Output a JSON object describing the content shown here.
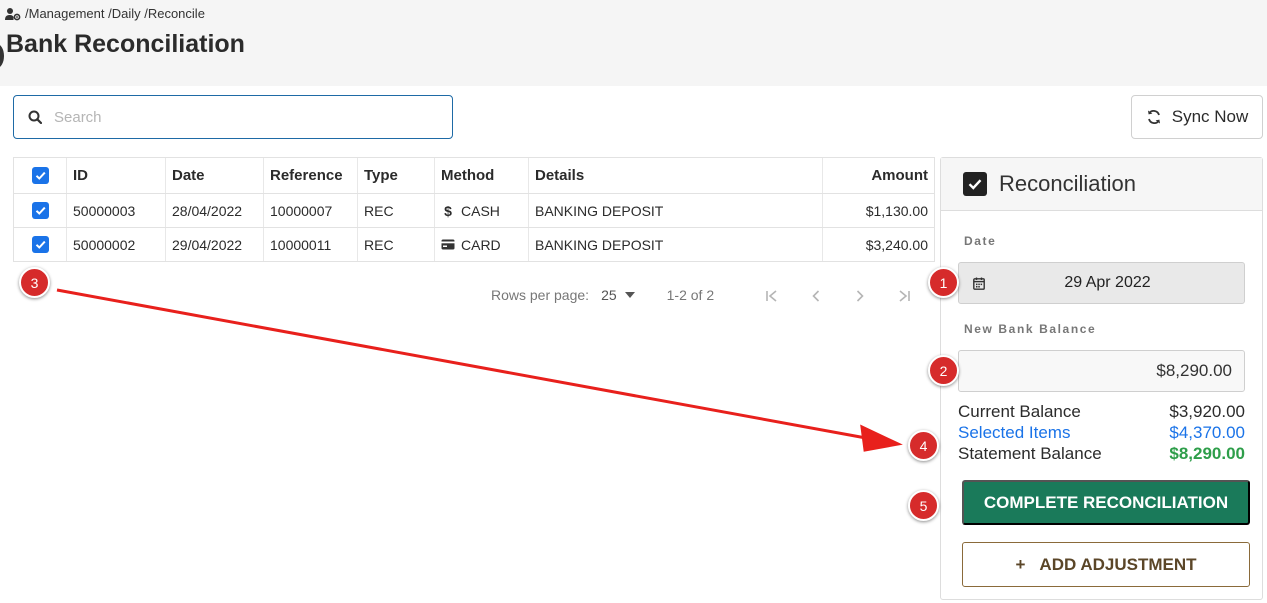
{
  "breadcrumb": "/Management /Daily /Reconcile",
  "page_title": "Bank Reconciliation",
  "search": {
    "placeholder": "Search"
  },
  "sync_button": "Sync Now",
  "table": {
    "headers": {
      "id": "ID",
      "date": "Date",
      "reference": "Reference",
      "type": "Type",
      "method": "Method",
      "details": "Details",
      "amount": "Amount"
    },
    "rows": [
      {
        "id": "50000003",
        "date": "28/04/2022",
        "reference": "10000007",
        "type": "REC",
        "method": "CASH",
        "method_icon": "dollar-icon",
        "details": "BANKING DEPOSIT",
        "amount": "$1,130.00",
        "checked": true
      },
      {
        "id": "50000002",
        "date": "29/04/2022",
        "reference": "10000011",
        "type": "REC",
        "method": "CARD",
        "method_icon": "credit-card-icon",
        "details": "BANKING DEPOSIT",
        "amount": "$3,240.00",
        "checked": true
      }
    ]
  },
  "pagination": {
    "rows_per_page_label": "Rows per page:",
    "rows_per_page": "25",
    "range": "1-2 of 2"
  },
  "reconciliation": {
    "title": "Reconciliation",
    "date_label": "Date",
    "date_value": "29 Apr 2022",
    "new_balance_label": "New Bank Balance",
    "new_balance_value": "$8,290.00",
    "current_balance_label": "Current Balance",
    "current_balance_value": "$3,920.00",
    "selected_items_label": "Selected Items",
    "selected_items_value": "$4,370.00",
    "statement_balance_label": "Statement Balance",
    "statement_balance_value": "$8,290.00",
    "complete_button": "COMPLETE RECONCILIATION",
    "adjust_button": "ADD ADJUSTMENT"
  },
  "markers": [
    "1",
    "2",
    "3",
    "4",
    "5"
  ],
  "colors": {
    "primary_blue": "#1a73e8",
    "complete_green": "#1a7a5a",
    "statement_green": "#2e9e4a",
    "marker_red": "#d62b2b",
    "adjust_brown": "#8a6a3a"
  }
}
